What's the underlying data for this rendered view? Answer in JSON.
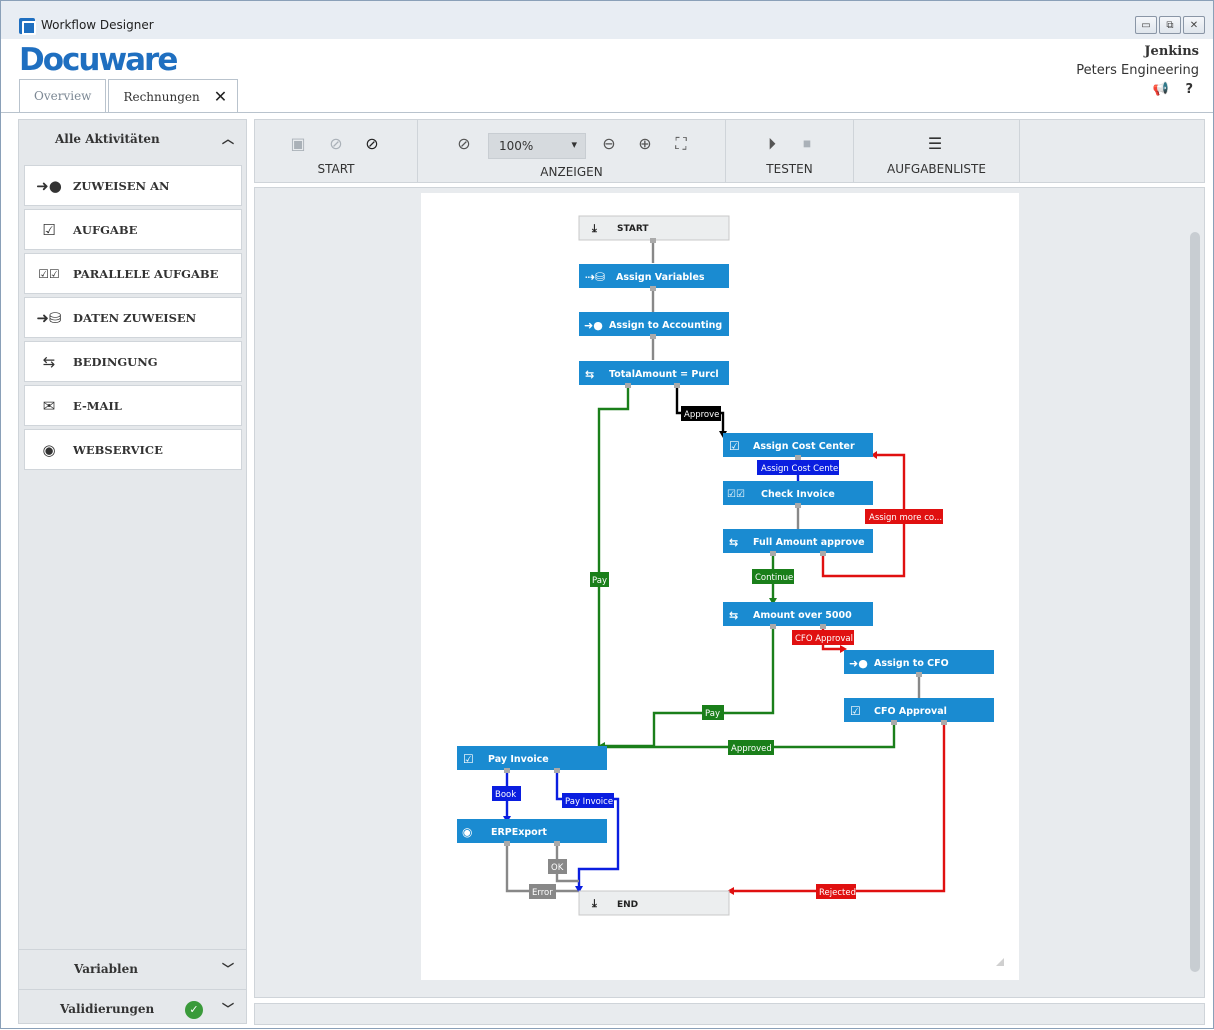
{
  "window": {
    "title": "Workflow Designer",
    "controls": [
      "▭",
      "⧉",
      "✕"
    ]
  },
  "brand": {
    "logo": "Docuware"
  },
  "user": {
    "name": "Jenkins",
    "company": "Peters Engineering",
    "icons": "📢 ?"
  },
  "tabs": [
    {
      "label": "Overview"
    },
    {
      "label": "Rechnungen",
      "close": "✕"
    }
  ],
  "sidebar": {
    "header": "Alle Aktivitäten",
    "items": [
      {
        "label": "ZUWEISEN AN",
        "icon": "assign-user-icon"
      },
      {
        "label": "AUFGABE",
        "icon": "task-icon"
      },
      {
        "label": "PARALLELE AUFGABE",
        "icon": "parallel-task-icon"
      },
      {
        "label": "DATEN ZUWEISEN",
        "icon": "assign-data-icon"
      },
      {
        "label": "BEDINGUNG",
        "icon": "condition-icon"
      },
      {
        "label": "E-MAIL",
        "icon": "email-icon"
      },
      {
        "label": "WEBSERVICE",
        "icon": "webservice-icon"
      }
    ],
    "variables": "Variablen",
    "validations": "Validierungen"
  },
  "ribbon": {
    "start": "START",
    "zoom": "100%",
    "anzeigen": "ANZEIGEN",
    "testen": "TESTEN",
    "aufgabenliste": "AUFGABENLISTE"
  },
  "workflow": {
    "nodes": {
      "start": "START",
      "assign_variables": "Assign Variables",
      "assign_accounting": "Assign to Accounting",
      "total_amount": "TotalAmount = Purcl",
      "assign_cost_center": "Assign Cost Center",
      "check_invoice": "Check Invoice",
      "full_amount": "Full Amount approve",
      "amount_over": "Amount over 5000",
      "assign_cfo": "Assign to CFO",
      "cfo_approval": "CFO Approval",
      "pay_invoice": "Pay Invoice",
      "erp_export": "ERPExport",
      "end": "END"
    },
    "labels": {
      "approve": "Approve",
      "assign_cost_center": "Assign Cost Center",
      "assign_more": "Assign more co...",
      "pay1": "Pay",
      "continue": "Continue",
      "cfo_approval": "CFO Approval",
      "pay2": "Pay",
      "approved": "Approved",
      "book": "Book",
      "pay_invoice": "Pay Invoice",
      "ok": "OK",
      "error": "Error",
      "rejected": "Rejected"
    },
    "colors": {
      "node": "#1a8bd1",
      "green": "#1a7f1a",
      "red": "#e01010",
      "blue": "#0a1ee0",
      "black": "#000000",
      "gray": "#888888"
    }
  }
}
